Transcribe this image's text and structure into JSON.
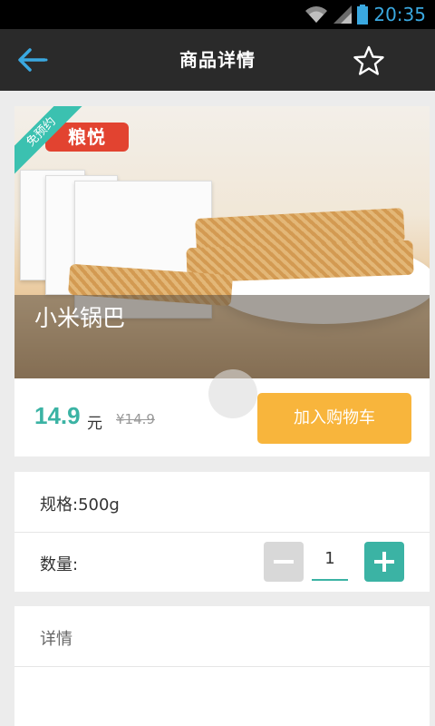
{
  "status_bar": {
    "time": "20:35"
  },
  "appbar": {
    "title": "商品详情"
  },
  "product": {
    "name": "小米锅巴",
    "brand_logo": "粮悦",
    "ribbon": "免预约",
    "price": "14.9",
    "unit": "元",
    "old_price": "¥14.9",
    "add_to_cart_label": "加入购物车"
  },
  "spec": {
    "label": "规格:500g"
  },
  "quantity": {
    "label": "数量:",
    "value": "1"
  },
  "detail": {
    "label": "详情"
  },
  "colors": {
    "accent": "#3bb3a4",
    "cart_button": "#f8b53c",
    "appbar": "#2a2a2a"
  },
  "icons": [
    "wifi-icon",
    "signal-icon",
    "battery-icon",
    "back-arrow-icon",
    "star-icon",
    "minus-icon",
    "plus-icon"
  ]
}
